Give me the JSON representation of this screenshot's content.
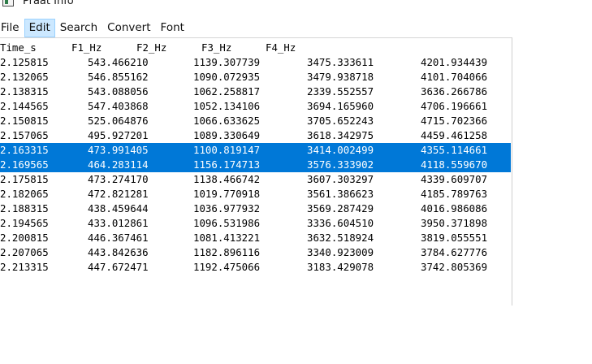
{
  "window": {
    "title": "Praat Info"
  },
  "menu": [
    "File",
    "Edit",
    "Search",
    "Convert",
    "Font"
  ],
  "table": {
    "headers": [
      "Time_s",
      "F1_Hz",
      "F2_Hz",
      "F3_Hz",
      "F4_Hz"
    ],
    "rows": [
      [
        "2.125815",
        "543.466210",
        "1139.307739",
        "3475.333611",
        "4201.934439"
      ],
      [
        "2.132065",
        "546.855162",
        "1090.072935",
        "3479.938718",
        "4101.704066"
      ],
      [
        "2.138315",
        "543.088056",
        "1062.258817",
        "2339.552557",
        "3636.266786"
      ],
      [
        "2.144565",
        "547.403868",
        "1052.134106",
        "3694.165960",
        "4706.196661"
      ],
      [
        "2.150815",
        "525.064876",
        "1066.633625",
        "3705.652243",
        "4715.702366"
      ],
      [
        "2.157065",
        "495.927201",
        "1089.330649",
        "3618.342975",
        "4459.461258"
      ],
      [
        "2.163315",
        "473.991405",
        "1100.819147",
        "3414.002499",
        "4355.114661"
      ],
      [
        "2.169565",
        "464.283114",
        "1156.174713",
        "3576.333902",
        "4118.559670"
      ],
      [
        "2.175815",
        "473.274170",
        "1138.466742",
        "3607.303297",
        "4339.609707"
      ],
      [
        "2.182065",
        "472.821281",
        "1019.770918",
        "3561.386623",
        "4185.789763"
      ],
      [
        "2.188315",
        "438.459644",
        "1036.977932",
        "3569.287429",
        "4016.986086"
      ],
      [
        "2.194565",
        "433.012861",
        "1096.531986",
        "3336.604510",
        "3950.371898"
      ],
      [
        "2.200815",
        "446.367461",
        "1081.413221",
        "3632.518924",
        "3819.055551"
      ],
      [
        "2.207065",
        "443.842636",
        "1182.896116",
        "3340.923009",
        "3784.627776"
      ],
      [
        "2.213315",
        "447.672471",
        "1192.475066",
        "3183.429078",
        "3742.805369"
      ]
    ],
    "selected_rows": [
      6,
      7
    ]
  }
}
